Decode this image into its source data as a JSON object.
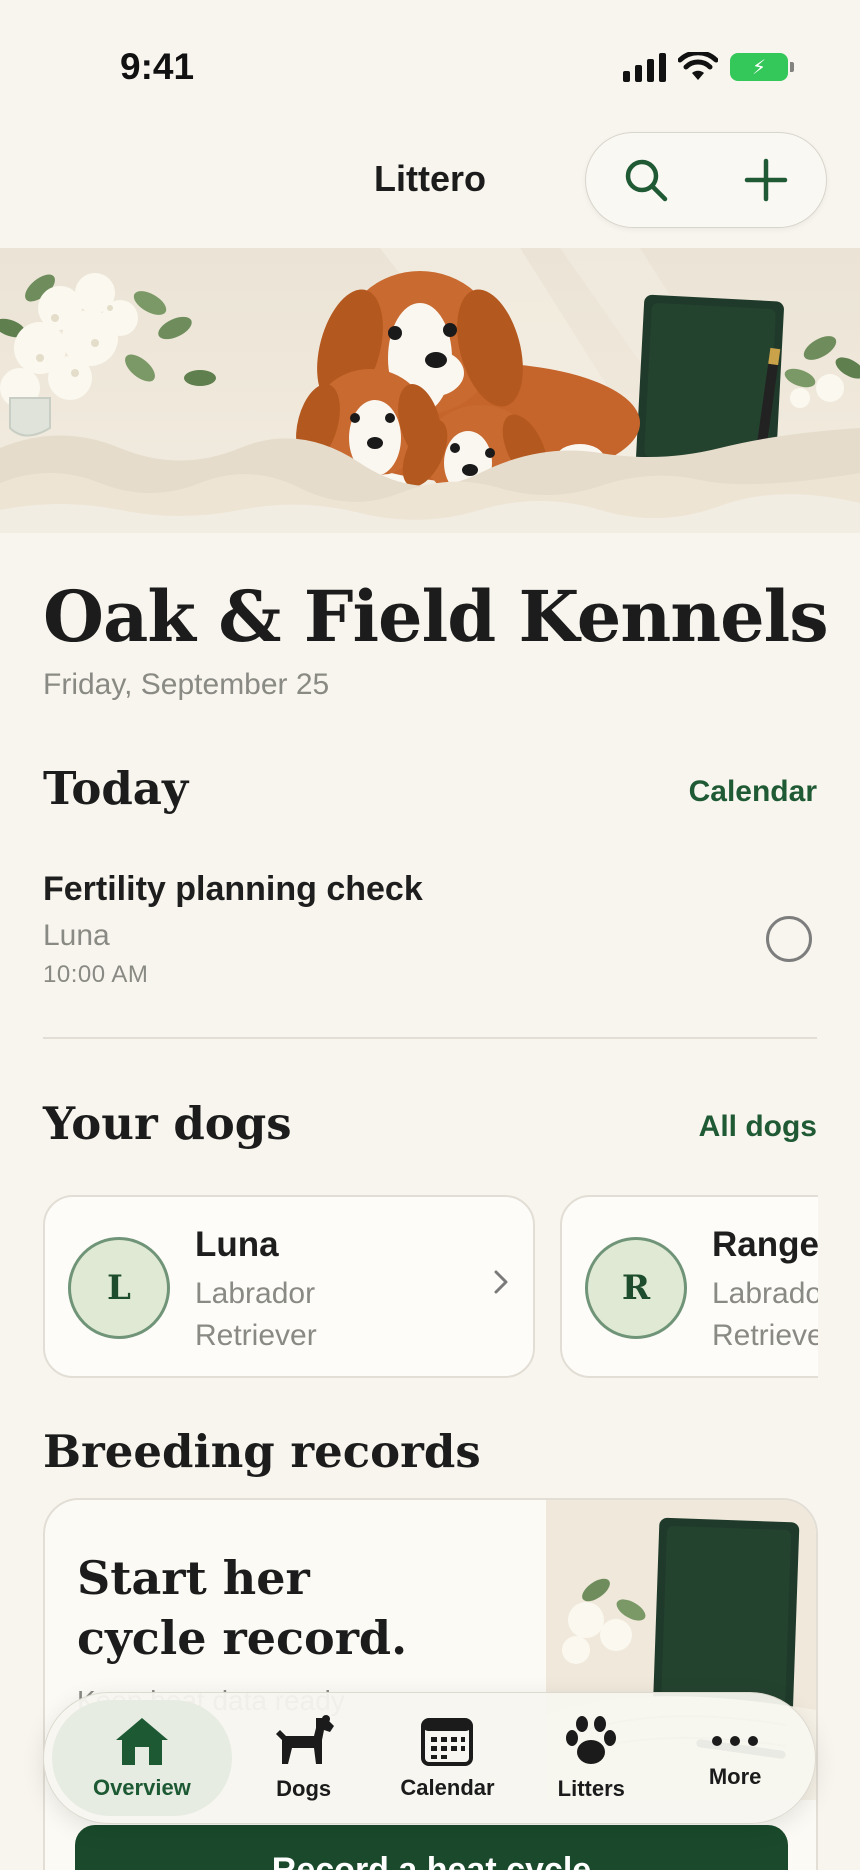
{
  "status_bar": {
    "time": "9:41"
  },
  "header": {
    "title": "Littero"
  },
  "kennel": {
    "name": "Oak & Field Kennels",
    "date": "Friday, September 25"
  },
  "today": {
    "title": "Today",
    "link": "Calendar",
    "tasks": [
      {
        "title": "Fertility planning check",
        "dog": "Luna",
        "time": "10:00 AM",
        "done": false
      }
    ]
  },
  "dogs": {
    "title": "Your dogs",
    "link": "All dogs",
    "items": [
      {
        "initial": "L",
        "name": "Luna",
        "breed_line1": "Labrador",
        "breed_line2": "Retriever"
      },
      {
        "initial": "R",
        "name": "Range",
        "breed_line1": "Labrador",
        "breed_line2": "Retriever"
      }
    ]
  },
  "breeding": {
    "title": "Breeding records",
    "headline_line1": "Start her",
    "headline_line2": "cycle record.",
    "subtitle": "Keep heat data ready",
    "cta": "Record a heat cycle"
  },
  "tabs": [
    {
      "label": "Overview",
      "icon": "house-icon",
      "active": true
    },
    {
      "label": "Dogs",
      "icon": "dog-icon",
      "active": false
    },
    {
      "label": "Calendar",
      "icon": "calendar-icon",
      "active": false
    },
    {
      "label": "Litters",
      "icon": "paw-icon",
      "active": false
    },
    {
      "label": "More",
      "icon": "more-icon",
      "active": false
    }
  ],
  "colors": {
    "accent": "#1f5a35",
    "background": "#f8f5ee",
    "cta": "#1a4a2b",
    "battery": "#34c759"
  }
}
